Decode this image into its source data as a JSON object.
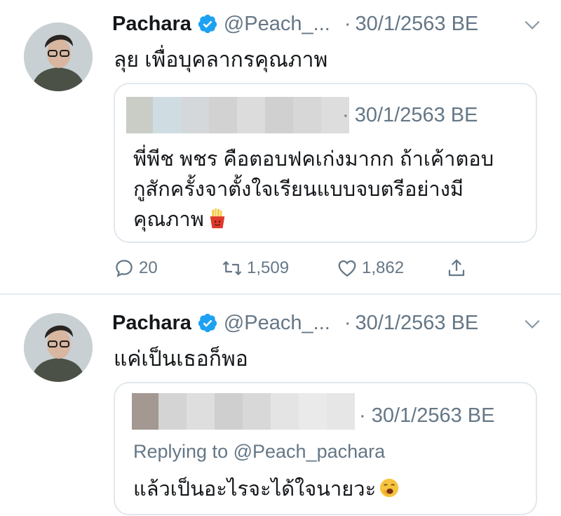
{
  "tweets": [
    {
      "author": {
        "name": "Pachara",
        "handle": "@Peach_...",
        "verified": true
      },
      "separator": "·",
      "date": "30/1/2563 BE",
      "text": "ลุย เพื่อบุคลากรคุณภาพ",
      "quote": {
        "separator": "·",
        "date": "30/1/2563 BE",
        "lines": [
          "พี่พีช พชร คือตอบฟคเก่งมากก ถ้าเค้าตอบ",
          "กูสักครั้งจาตั้งใจเรียนแบบจบตรีอย่างมี",
          "คุณภาพ"
        ],
        "emoji": "fries-emoji"
      },
      "actions": {
        "replies": "20",
        "retweets": "1,509",
        "likes": "1,862"
      }
    },
    {
      "author": {
        "name": "Pachara",
        "handle": "@Peach_...",
        "verified": true
      },
      "separator": "·",
      "date": "30/1/2563 BE",
      "text": "แค่เป็นเธอก็พอ",
      "quote": {
        "separator": "·",
        "date": "30/1/2563 BE",
        "replying_prefix": "Replying to",
        "replying_handle": "@Peach_pachara",
        "line": "แล้วเป็นอะไรจะได้ใจนายวะ",
        "emoji": "yawning-face-emoji"
      }
    }
  ],
  "colors": {
    "text": "#14171a",
    "muted": "#657786",
    "verified": "#1da1f2",
    "border": "#e1e8ed"
  }
}
